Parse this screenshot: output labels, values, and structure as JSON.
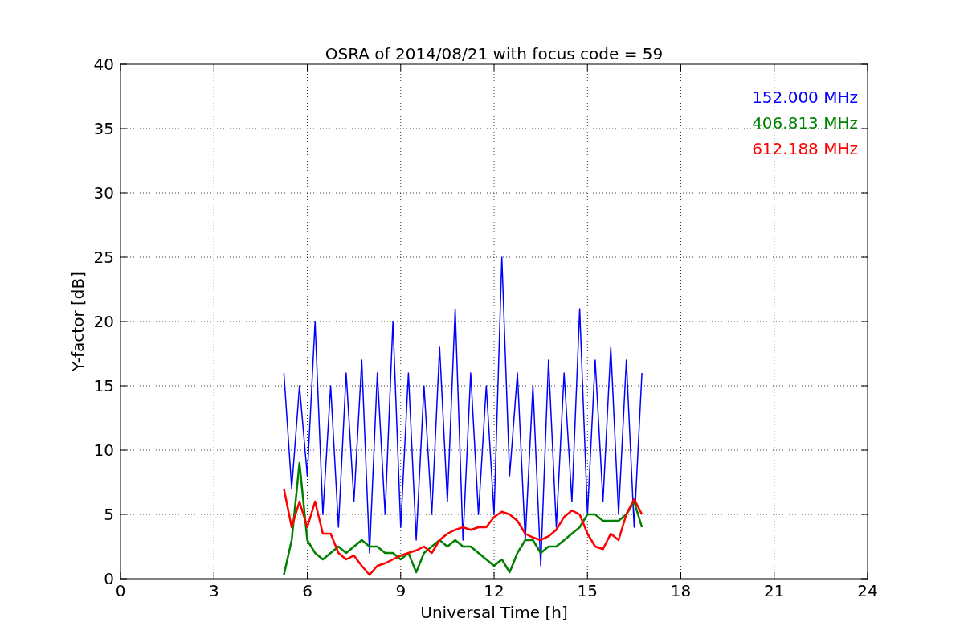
{
  "chart_data": {
    "type": "line",
    "title": "OSRA of 2014/08/21 with focus code = 59",
    "xlabel": "Universal Time [h]",
    "ylabel": "Y-factor [dB]",
    "x": [
      5.25,
      5.5,
      5.75,
      6,
      6.25,
      6.5,
      6.75,
      7,
      7.25,
      7.5,
      7.75,
      8,
      8.25,
      8.5,
      8.75,
      9,
      9.25,
      9.5,
      9.75,
      10,
      10.25,
      10.5,
      10.75,
      11,
      11.25,
      11.5,
      11.75,
      12,
      12.25,
      12.5,
      12.75,
      13,
      13.25,
      13.5,
      13.75,
      14,
      14.25,
      14.5,
      14.75,
      15,
      15.25,
      15.5,
      15.75,
      16,
      16.25,
      16.5,
      16.75
    ],
    "series": [
      {
        "name": "152.000 MHz",
        "color": "#0000ff",
        "values": [
          16,
          7,
          15,
          8,
          20,
          5,
          15,
          4,
          16,
          6,
          17,
          2,
          16,
          5,
          20,
          4,
          16,
          3,
          15,
          5,
          18,
          6,
          21,
          3,
          16,
          5,
          15,
          5,
          25,
          8,
          16,
          3,
          15,
          1,
          17,
          4,
          16,
          6,
          21,
          5,
          17,
          6,
          18,
          5,
          17,
          4,
          16
        ]
      },
      {
        "name": "406.813 MHz",
        "color": "#008000",
        "values": [
          0.3,
          3,
          9,
          3,
          2,
          1.5,
          2,
          2.5,
          2,
          2.5,
          3,
          2.5,
          2.5,
          2,
          2,
          1.5,
          2,
          0.5,
          2,
          2.5,
          3,
          2.5,
          3,
          2.5,
          2.5,
          2,
          1.5,
          1,
          1.5,
          0.5,
          2,
          3,
          3,
          2,
          2.5,
          2.5,
          3,
          3.5,
          4,
          5,
          5,
          4.5,
          4.5,
          4.5,
          5,
          6,
          4
        ]
      },
      {
        "name": "612.188 MHz",
        "color": "#ff0000",
        "values": [
          7,
          4,
          6,
          4,
          6,
          3.5,
          3.5,
          2,
          1.5,
          1.8,
          1,
          0.3,
          1,
          1.2,
          1.5,
          1.8,
          2,
          2.2,
          2.5,
          2,
          3,
          3.5,
          3.8,
          4,
          3.8,
          4,
          4,
          4.8,
          5.2,
          5,
          4.5,
          3.5,
          3.2,
          3,
          3.3,
          3.8,
          4.8,
          5.3,
          5,
          3.5,
          2.5,
          2.3,
          3.5,
          3,
          5,
          6.2,
          5
        ]
      }
    ],
    "xlim": [
      0,
      24
    ],
    "ylim": [
      0,
      40
    ],
    "xticks": [
      0,
      3,
      6,
      9,
      12,
      15,
      18,
      21,
      24
    ],
    "yticks": [
      0,
      5,
      10,
      15,
      20,
      25,
      30,
      35,
      40
    ],
    "grid": true
  }
}
